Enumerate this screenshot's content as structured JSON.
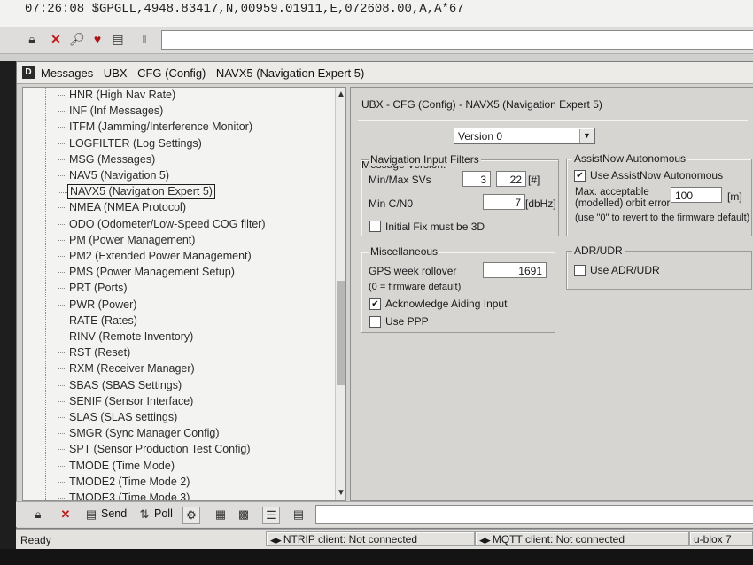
{
  "nmea_line": "07:26:08  $GPGLL,4948.83417,N,00959.01911,E,072608.00,A,A*67",
  "window": {
    "title": "Messages - UBX - CFG (Config) - NAVX5 (Navigation Expert 5)",
    "logo": "D"
  },
  "tree": {
    "items": [
      "HNR (High Nav Rate)",
      "INF (Inf Messages)",
      "ITFM (Jamming/Interference Monitor)",
      "LOGFILTER (Log Settings)",
      "MSG (Messages)",
      "NAV5 (Navigation 5)",
      "NAVX5 (Navigation Expert 5)",
      "NMEA (NMEA Protocol)",
      "ODO (Odometer/Low-Speed COG filter)",
      "PM (Power Management)",
      "PM2 (Extended Power Management)",
      "PMS (Power Management Setup)",
      "PRT (Ports)",
      "PWR (Power)",
      "RATE (Rates)",
      "RINV (Remote Inventory)",
      "RST (Reset)",
      "RXM (Receiver Manager)",
      "SBAS (SBAS Settings)",
      "SENIF (Sensor Interface)",
      "SLAS (SLAS settings)",
      "SMGR (Sync Manager Config)",
      "SPT (Sensor Production Test Config)",
      "TMODE (Time Mode)",
      "TMODE2 (Time Mode 2)",
      "TMODE3 (Time Mode 3)"
    ],
    "selected_index": 6
  },
  "config": {
    "title": "UBX - CFG (Config) - NAVX5 (Navigation Expert 5)",
    "message_version_label": "Message Version:",
    "message_version_value": "Version 0",
    "nav_filters": {
      "title": "Navigation Input Filters",
      "min_max_svs_label": "Min/Max SVs",
      "min_svs": "3",
      "max_svs": "22",
      "svs_unit": "[#]",
      "min_cno_label": "Min C/N0",
      "min_cno": "7",
      "cno_unit": "[dbHz]",
      "initial_fix_label": "Initial Fix must be 3D",
      "initial_fix_checked": false
    },
    "misc": {
      "title": "Miscellaneous",
      "gps_week_label": "GPS week rollover",
      "gps_week_value": "1691",
      "gps_week_note": "(0 = firmware default)",
      "ack_aiding_label": "Acknowledge Aiding Input",
      "ack_aiding_checked": true,
      "use_ppp_label": "Use PPP",
      "use_ppp_checked": false
    },
    "assistnow": {
      "title": "AssistNow Autonomous",
      "use_label": "Use AssistNow Autonomous",
      "use_checked": true,
      "max_orbit_label_1": "Max. acceptable",
      "max_orbit_label_2": "(modelled) orbit error",
      "max_orbit_value": "100",
      "max_orbit_unit": "[m]",
      "note": "(use \"0\" to revert to the firmware default)"
    },
    "adr": {
      "title": "ADR/UDR",
      "use_label": "Use ADR/UDR",
      "use_checked": false
    }
  },
  "bottom_toolbar": {
    "send_label": "Send",
    "poll_label": "Poll"
  },
  "status": {
    "ready": "Ready",
    "ntrip": "NTRIP client: Not connected",
    "mqtt": "MQTT client: Not connected",
    "device": "u-blox 7"
  },
  "icons": {
    "lock": "lock-icon",
    "close": "close-x-icon",
    "settings": "settings-icon",
    "check_mark": "✔"
  }
}
